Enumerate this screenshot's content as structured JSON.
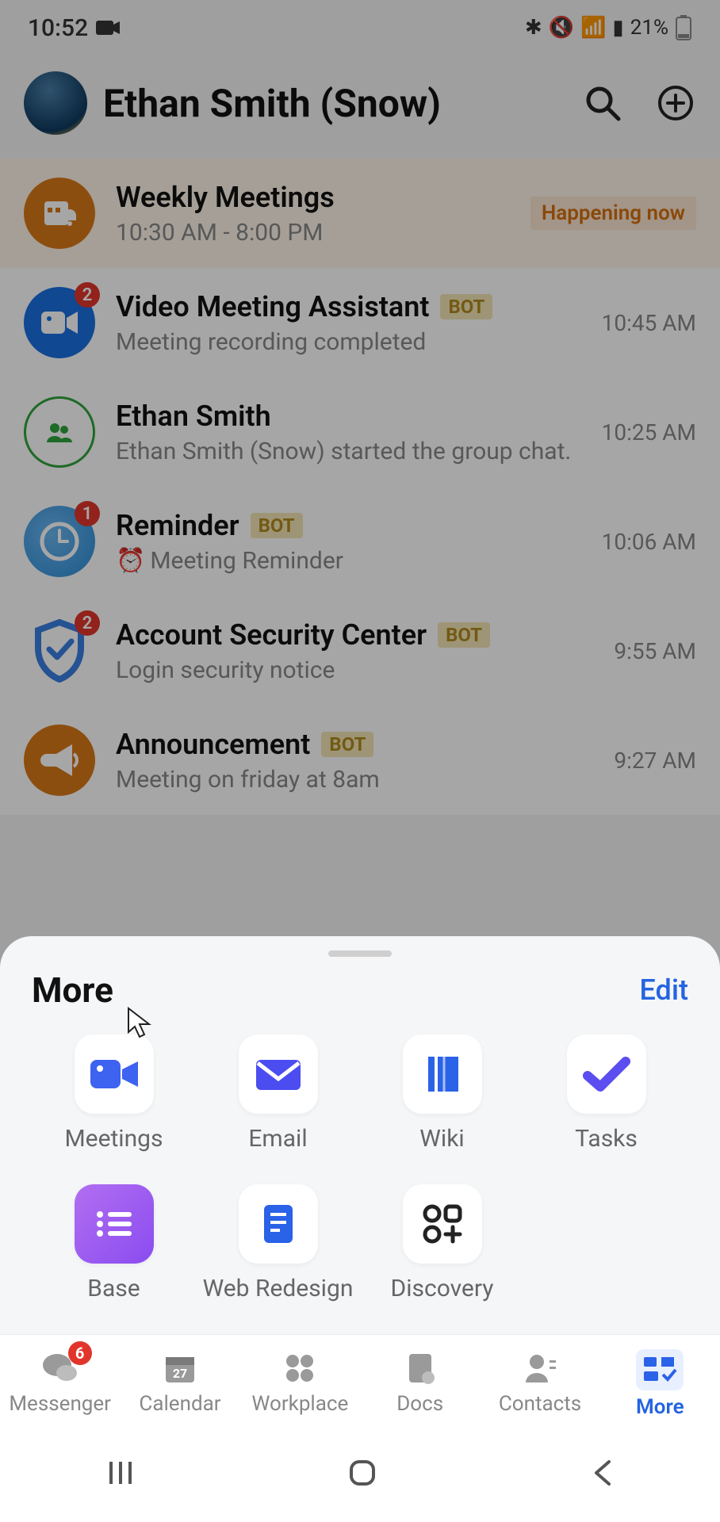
{
  "status": {
    "time": "10:52",
    "battery": "21%"
  },
  "header": {
    "title": "Ethan Smith (Snow)"
  },
  "chats": [
    {
      "title": "Weekly Meetings",
      "sub": "10:30 AM - 8:00 PM",
      "time": "",
      "nowLabel": "Happening now"
    },
    {
      "title": "Video Meeting Assistant",
      "sub": "Meeting recording completed",
      "time": "10:45 AM",
      "bot": "BOT",
      "badge": "2"
    },
    {
      "title": "Ethan Smith",
      "sub": "Ethan Smith (Snow) started the group chat.",
      "time": "10:25 AM"
    },
    {
      "title": "Reminder",
      "sub": "Meeting Reminder",
      "time": "10:06 AM",
      "bot": "BOT",
      "badge": "1"
    },
    {
      "title": "Account Security Center",
      "sub": "Login security notice",
      "time": "9:55 AM",
      "bot": "BOT",
      "badge": "2"
    },
    {
      "title": "Announcement",
      "sub": "Meeting on friday at 8am",
      "time": "9:27 AM",
      "bot": "BOT"
    }
  ],
  "sheet": {
    "title": "More",
    "edit": "Edit",
    "apps": [
      {
        "label": "Meetings"
      },
      {
        "label": "Email"
      },
      {
        "label": "Wiki"
      },
      {
        "label": "Tasks"
      },
      {
        "label": "Base"
      },
      {
        "label": "Web Redesign"
      },
      {
        "label": "Discovery"
      }
    ]
  },
  "nav": {
    "messenger": {
      "label": "Messenger",
      "badge": "6"
    },
    "calendar": {
      "label": "Calendar",
      "day": "27"
    },
    "workplace": {
      "label": "Workplace"
    },
    "docs": {
      "label": "Docs"
    },
    "contacts": {
      "label": "Contacts"
    },
    "more": {
      "label": "More"
    }
  }
}
